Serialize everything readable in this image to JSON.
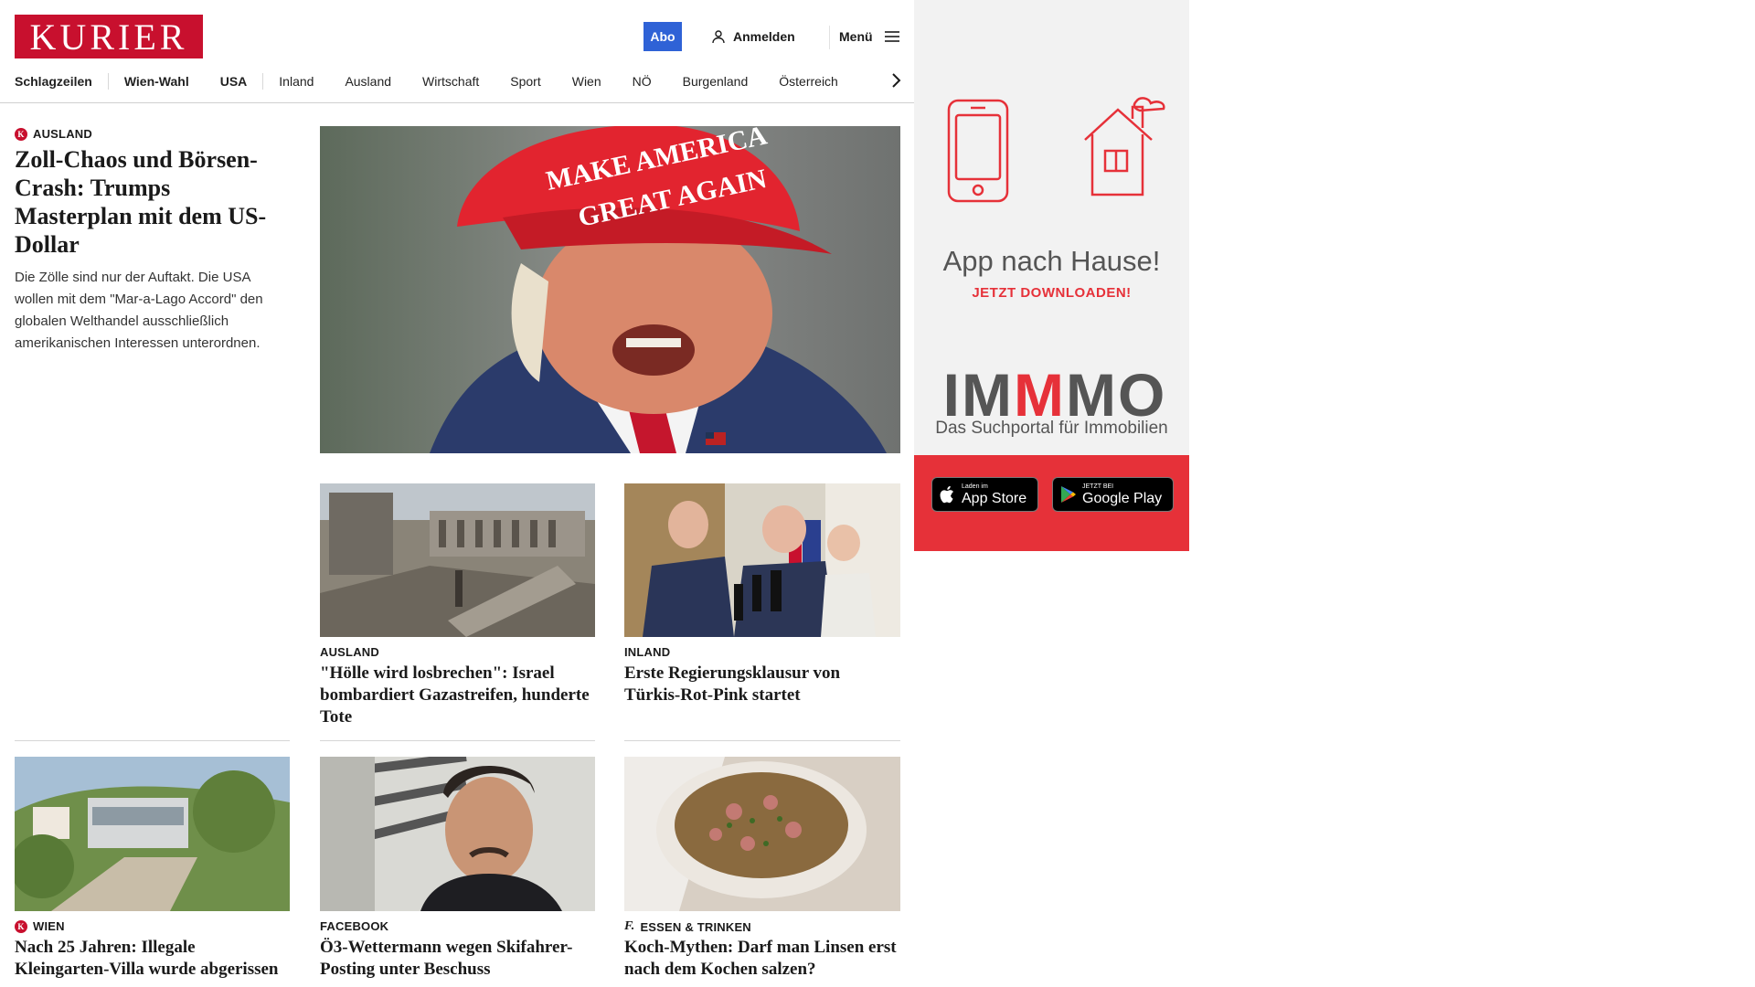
{
  "brand": {
    "logo_text": "KURIER",
    "color": "#c8102e"
  },
  "header": {
    "abo_label": "Abo",
    "login_label": "Anmelden",
    "menu_label": "Menü"
  },
  "nav": {
    "items": [
      "Schlagzeilen",
      "Wien-Wahl",
      "USA",
      "Inland",
      "Ausland",
      "Wirtschaft",
      "Sport",
      "Wien",
      "NÖ",
      "Burgenland",
      "Österreich"
    ]
  },
  "lead": {
    "kicker": "AUSLAND",
    "title": "Zoll-Chaos und Börsen-Crash: Trumps Masterplan mit dem US-Dollar",
    "teaser": "Die Zölle sind nur der Auftakt. Die USA wollen mit dem \"Mar-a-Lago Accord\" den globalen Welthandel ausschließlich amerikanischen Interessen unterordnen.",
    "cap_text_1": "MAKE AMERICA",
    "cap_text_2": "GREAT AGAIN"
  },
  "articles": [
    {
      "kicker": "AUSLAND",
      "title": "\"Hölle wird losbrechen\": Israel bombardiert Gazastreifen, hunderte Tote"
    },
    {
      "kicker": "INLAND",
      "title": "Erste Regierungsklausur von Türkis-Rot-Pink startet"
    },
    {
      "kicker": "WIEN",
      "title": "Nach 25 Jahren: Illegale Kleingarten-Villa wurde abgerissen"
    },
    {
      "kicker": "FACEBOOK",
      "title": "Ö3-Wettermann wegen Skifahrer-Posting unter Beschuss"
    },
    {
      "kicker": "ESSEN & TRINKEN",
      "title": "Koch-Mythen: Darf man Linsen erst nach dem Kochen salzen?"
    }
  ],
  "ad": {
    "headline": "App nach Hause!",
    "subline": "JETZT DOWNLOADEN!",
    "logo_part1": "IM",
    "logo_part2": "M",
    "logo_part3": "MO",
    "tagline": "Das Suchportal für Immobilien",
    "appstore_small": "Laden im",
    "appstore_big": "App Store",
    "gplay_small": "JETZT BEI",
    "gplay_big": "Google Play",
    "red": "#e63139"
  },
  "icons": [
    "user-icon",
    "hamburger-icon",
    "chevron-right-icon",
    "k-badge-icon",
    "f-badge-icon",
    "apple-icon",
    "google-play-icon"
  ]
}
